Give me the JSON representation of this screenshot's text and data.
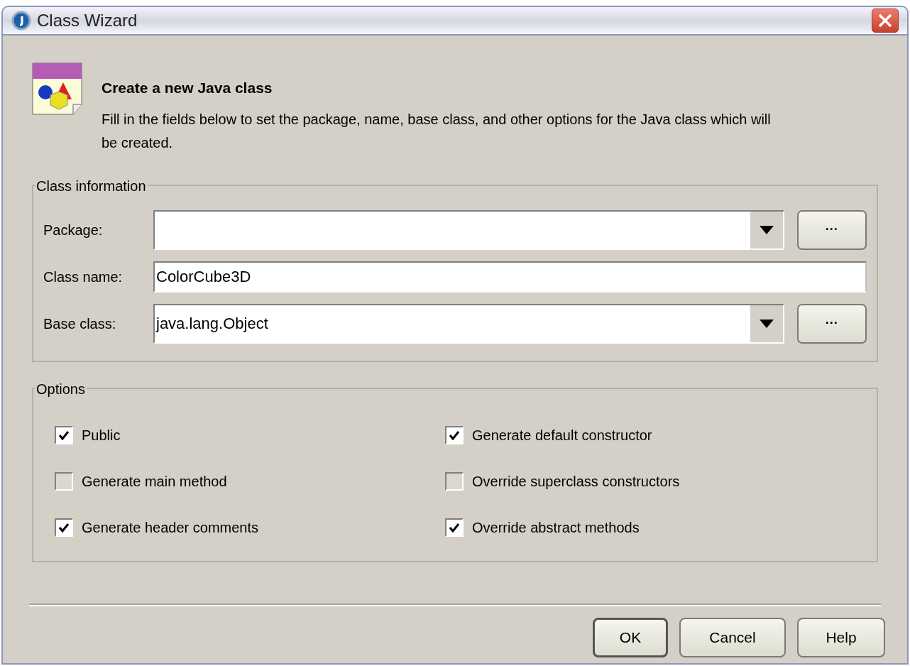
{
  "window": {
    "title": "Class Wizard"
  },
  "header": {
    "title": "Create a new Java class",
    "description": "Fill in the fields below to set the package, name, base class, and other options for the Java class which will be created."
  },
  "class_information": {
    "legend": "Class information",
    "fields": [
      {
        "kind": "combo",
        "label": "Package:",
        "browse": "···"
      },
      {
        "kind": "text",
        "label": "Class name:",
        "value": "ColorCube3D"
      },
      {
        "kind": "combo",
        "label": "Base class:",
        "value": "java.lang.Object",
        "browse": "···"
      }
    ]
  },
  "options": {
    "legend": "Options",
    "items": [
      {
        "label": "Public",
        "checked": true
      },
      {
        "label": "Generate default constructor",
        "checked": true
      },
      {
        "label": "Generate main method",
        "checked": false
      },
      {
        "label": "Override superclass constructors",
        "checked": false
      },
      {
        "label": "Generate header comments",
        "checked": true
      },
      {
        "label": "Override abstract methods",
        "checked": true
      }
    ]
  },
  "buttons": [
    {
      "label": "OK",
      "default": true
    },
    {
      "label": "Cancel",
      "default": false
    },
    {
      "label": "Help",
      "default": false
    }
  ]
}
